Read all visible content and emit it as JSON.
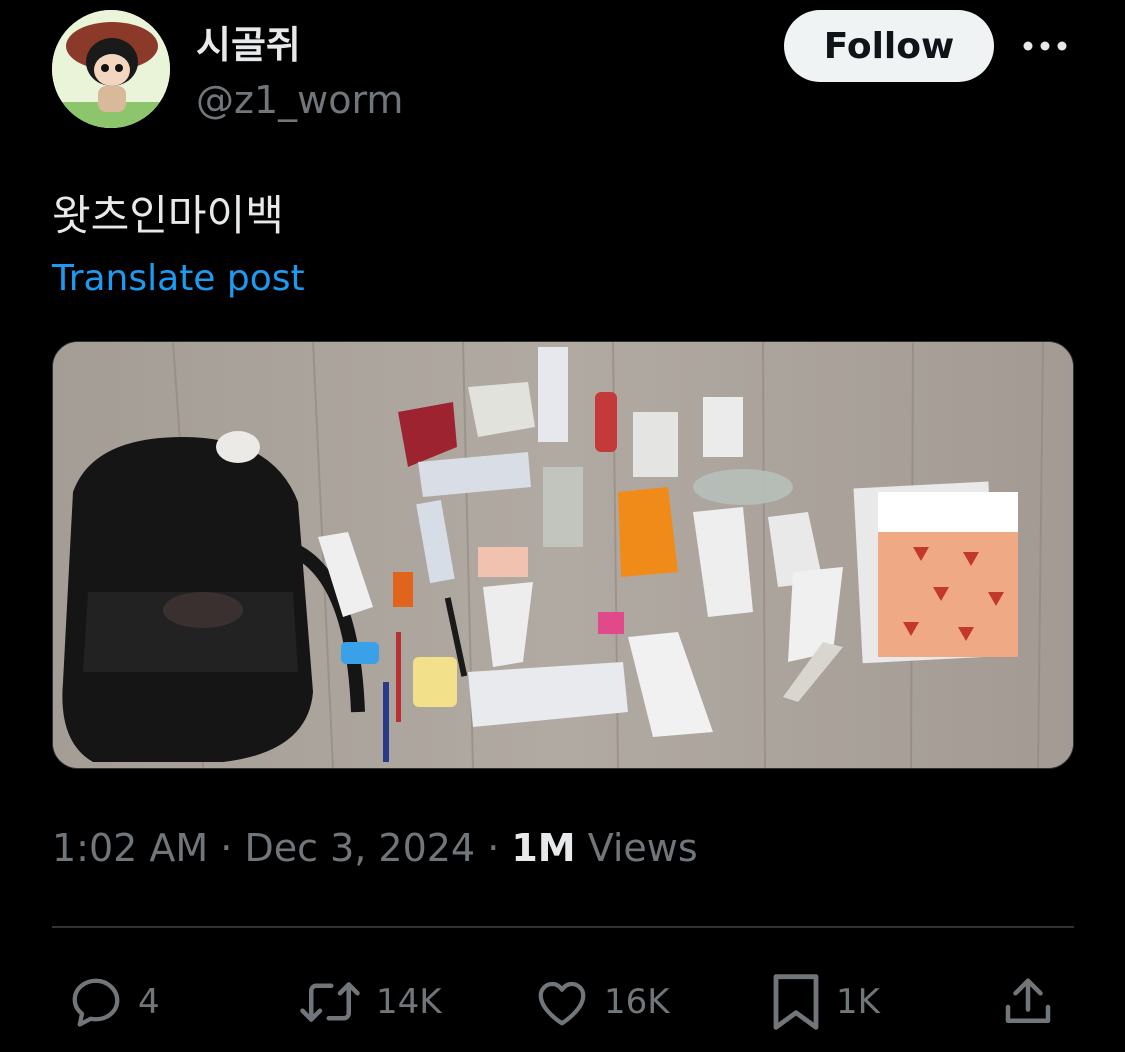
{
  "author": {
    "display_name": "시골쥐",
    "handle": "@z1_worm",
    "avatar_icon": "profile-avatar"
  },
  "follow_label": "Follow",
  "more_icon": "more-dots-icon",
  "post": {
    "text": "왓츠인마이백",
    "translate_label": "Translate post",
    "image_icon": "attached-photo"
  },
  "meta": {
    "time": "1:02 AM",
    "sep1": " · ",
    "date": "Dec 3, 2024",
    "sep2": " · ",
    "views_count": "1M",
    "views_label": " Views"
  },
  "actions": {
    "reply": {
      "icon": "reply-icon",
      "count": "4"
    },
    "repost": {
      "icon": "repost-icon",
      "count": "14K"
    },
    "like": {
      "icon": "heart-icon",
      "count": "16K"
    },
    "bookmark": {
      "icon": "bookmark-icon",
      "count": "1K"
    },
    "share": {
      "icon": "share-icon"
    }
  },
  "colors": {
    "background": "#000000",
    "text_primary": "#e7e9ea",
    "text_secondary": "#71767b",
    "link": "#1d9bf0",
    "follow_bg": "#eff3f4",
    "divider": "#2f3336"
  }
}
